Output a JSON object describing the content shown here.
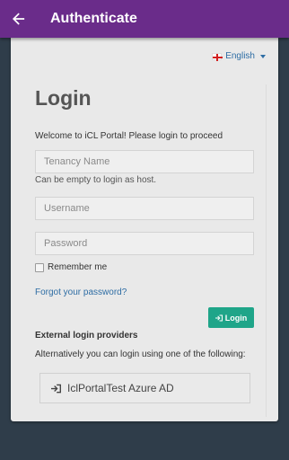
{
  "appbar": {
    "title": "Authenticate",
    "back_icon": "arrow-left-icon",
    "color": "#6a2c8a"
  },
  "language": {
    "label": "English",
    "flag_icon": "england-flag-icon"
  },
  "login": {
    "title": "Login",
    "welcome": "Welcome to iCL Portal! Please login to proceed",
    "tenancy_placeholder": "Tenancy Name",
    "tenancy_help": "Can be empty to login as host.",
    "username_placeholder": "Username",
    "password_placeholder": "Password",
    "remember_label": "Remember me",
    "forgot_link": "Forgot your password?",
    "submit_label": "Login",
    "submit_color": "#1fa589"
  },
  "external": {
    "title": "External login providers",
    "description": "Alternatively you can login using one of the following:",
    "provider_label": "IclPortalTest Azure AD",
    "provider_icon": "sign-in-icon"
  }
}
